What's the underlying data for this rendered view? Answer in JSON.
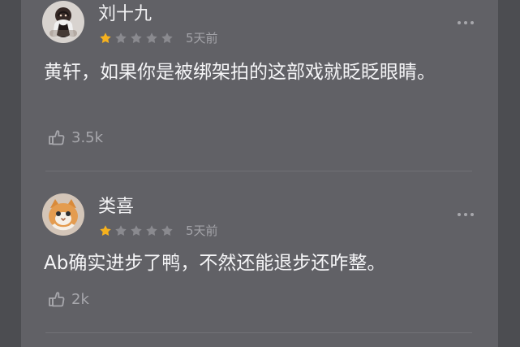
{
  "comments": [
    {
      "username": "刘十九",
      "rating": 1,
      "time": "5天前",
      "text": "黄轩，如果你是被绑架拍的这部戏就眨眨眼睛。",
      "likes": "3.5k",
      "avatar": "woman-photo-avatar",
      "more_icon": "more-icon",
      "like_icon": "thumbs-up-icon"
    },
    {
      "username": "类喜",
      "rating": 1,
      "time": "5天前",
      "text": "Ab确实进步了鸭，不然还能退步还咋整。",
      "likes": "2k",
      "avatar": "cat-photo-avatar",
      "more_icon": "more-icon",
      "like_icon": "thumbs-up-icon"
    }
  ],
  "colors": {
    "star_filled": "#f5b11e",
    "star_empty": "#8a8a8f",
    "panel": "#616166",
    "background": "#4c4d51"
  }
}
